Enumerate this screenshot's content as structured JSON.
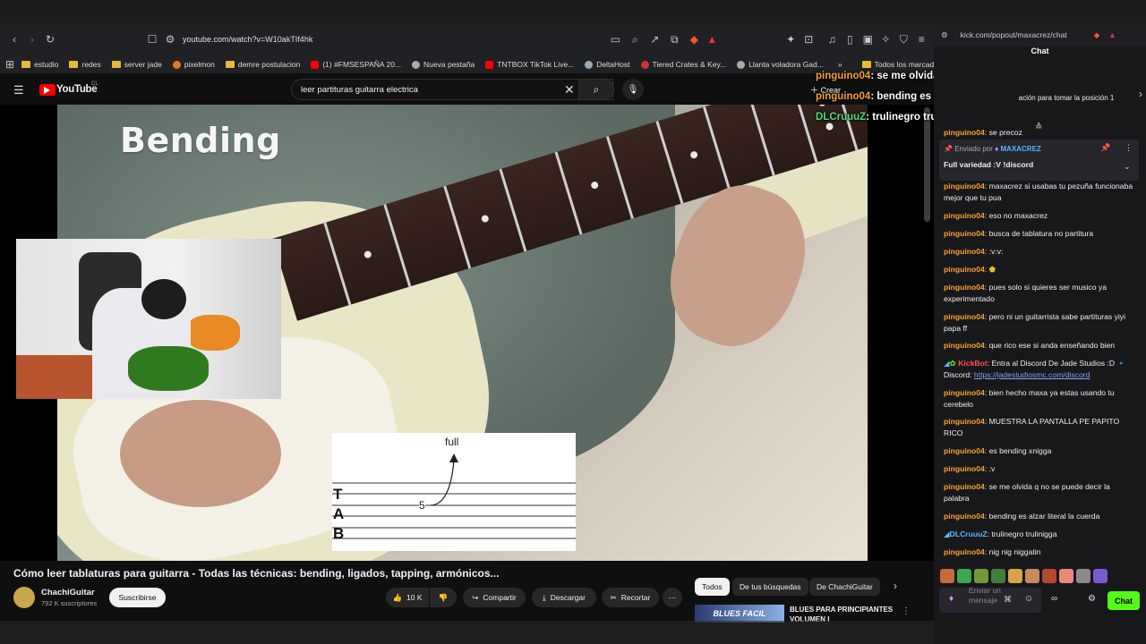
{
  "browser": {
    "url": "youtube.com/watch?v=W10akTIf4hk",
    "bookmarks": [
      "estudio",
      "redes",
      "server jade",
      "pixelmon",
      "demre postulacion",
      "(1) #FMSESPAÑA 20...",
      "Nueva pestaña",
      "TNTBOX TikTok Live...",
      "DeltaHost",
      "Tiered Crates & Key...",
      "Llanta voladora Gad..."
    ],
    "all_bookmarks": "Todos los marcadores"
  },
  "youtube": {
    "logo": "YouTube",
    "region": "CL",
    "search_value": "leer partituras guitarra electrica",
    "create_label": "Crear",
    "video_overlay_title": "Bending",
    "tab_text": {
      "full": "full",
      "fret": "5",
      "t": "T",
      "a": "A",
      "b": "B"
    },
    "video_title": "Cómo leer tablaturas para guitarra - Todas las técnicas: bending, ligados, tapping, armónicos...",
    "channel": "ChachiGuitar",
    "subscribers": "792 K suscriptores",
    "subscribe_label": "Suscribirse",
    "likes": "10 K",
    "share_label": "Compartir",
    "download_label": "Descargar",
    "clip_label": "Recortar",
    "chips": [
      "Todos",
      "De tus búsquedas",
      "De ChachiGuitar"
    ],
    "rec": {
      "thumb_text": "BLUES FACIL",
      "title": "BLUES PARA PRINCIPIANTES VOLUMEN I"
    }
  },
  "overlay_chat": [
    {
      "user": "pinguino04",
      "text": "se me olvida q no se puede decir la palabra"
    },
    {
      "user": "pinguino04",
      "text": "bending es alzar literal la cuerda"
    },
    {
      "user": "DLCruuuZ",
      "text": "trulinegro trulinigga"
    }
  ],
  "chat": {
    "url": "kick.com/popout/maxacrez/chat",
    "header": "Chat",
    "top_notice": "ación para tomar la posición 1",
    "pinned_by": "Enviado por",
    "pinned_user": "MAXACREZ",
    "pinned_text": "Full variedad :V !discord",
    "input_placeholder": "Enviar un mensaje",
    "send_label": "Chat",
    "messages": [
      {
        "user": "pinguino04",
        "text": ": se precoz"
      },
      {
        "user": "pinguino04",
        "text": ": maxacrez si usabas tu pezuña funcionaba mejor que tu pua"
      },
      {
        "user": "pinguino04",
        "text": ": eso no maxacrez"
      },
      {
        "user": "pinguino04",
        "text": ": busca de tablatura no partitura"
      },
      {
        "user": "pinguino04",
        "text": ": :v:v:"
      },
      {
        "user": "pinguino04",
        "text": ":"
      },
      {
        "user": "pinguino04",
        "text": ": pues solo si quieres ser musico ya experimentado"
      },
      {
        "user": "pinguino04",
        "text": ": pero ni un guitarrista sabe partituras yiyi papa ff"
      },
      {
        "user": "pinguino04",
        "text": ": que rico ese si anda enseñando bien"
      },
      {
        "user": "KickBot",
        "text": ": Entra al Discord De Jade Studios :D 🔹 Discord:",
        "link": "https://jadestudiosmc.com/discord"
      },
      {
        "user": "pinguino04",
        "text": ": bien hecho maxa ya estas usando tu cerebelo"
      },
      {
        "user": "pinguino04",
        "text": ": MUESTRA LA PANTALLA PE PAPITO RICO"
      },
      {
        "user": "pinguino04",
        "text": ": es bending xnigga"
      },
      {
        "user": "pinguino04",
        "text": ": :v"
      },
      {
        "user": "pinguino04",
        "text": ": se me olvida q no se puede decir la palabra"
      },
      {
        "user": "pinguino04",
        "text": ": bending es alzar literal la cuerda"
      },
      {
        "user": "DLCruuuZ",
        "text": ": trulinegro trulinigga"
      },
      {
        "user": "pinguino04",
        "text": ": nig nig niggatin"
      }
    ]
  },
  "colors": {
    "kick_green": "#53fc18",
    "user_orange": "#f7a034",
    "user_blue": "#57b8ff",
    "youtube_red": "#ff0000"
  }
}
